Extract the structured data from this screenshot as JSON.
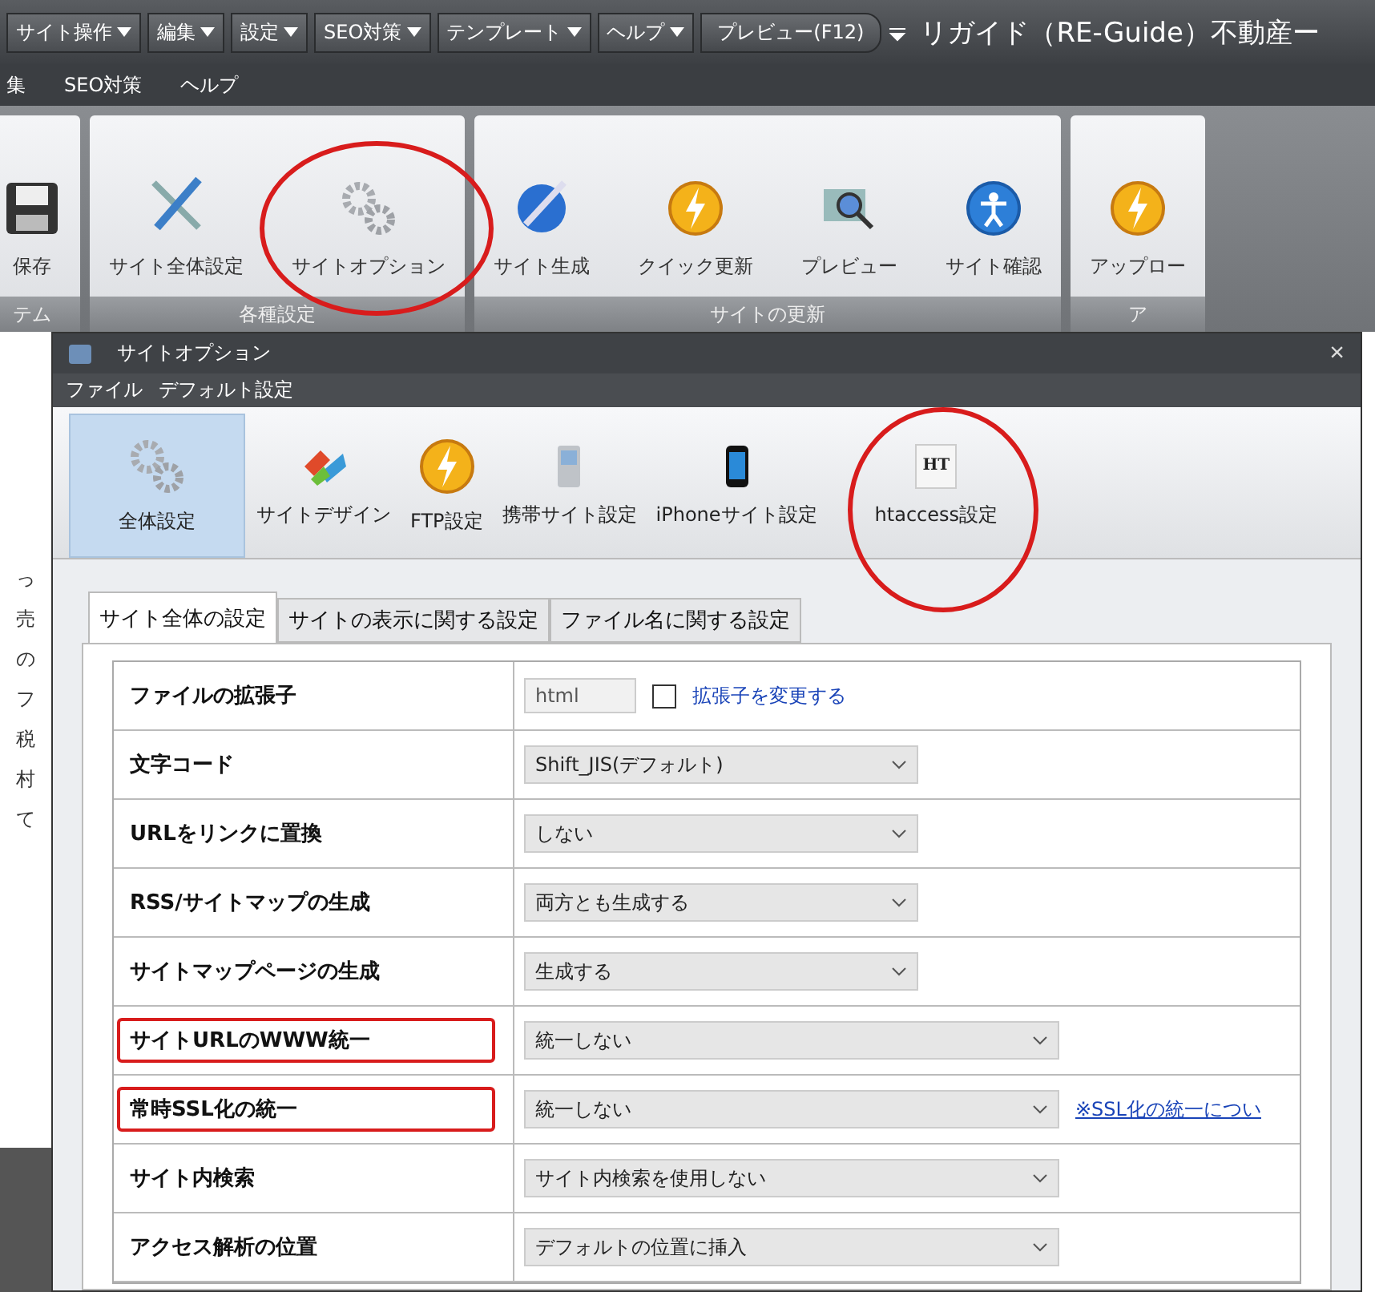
{
  "quick_bar": {
    "menus": [
      {
        "label": "サイト操作"
      },
      {
        "label": "編集"
      },
      {
        "label": "設定"
      },
      {
        "label": "SEO対策"
      },
      {
        "label": "テンプレート"
      },
      {
        "label": "ヘルプ"
      }
    ],
    "preview_button": "プレビュー(F12)",
    "title": "リガイド（RE-Guide）不動産ー"
  },
  "menu_bar": [
    "集",
    "SEO対策",
    "ヘルプ"
  ],
  "ribbon": {
    "groups": [
      {
        "label": "テム",
        "buttons": [
          {
            "label": "保存",
            "circled": false
          }
        ]
      },
      {
        "label": "各種設定",
        "buttons": [
          {
            "label": "サイト全体設定",
            "circled": false
          },
          {
            "label": "サイトオプション",
            "circled": true
          }
        ]
      },
      {
        "label": "サイトの更新",
        "buttons": [
          {
            "label": "サイト生成",
            "circled": false
          },
          {
            "label": "クイック更新",
            "circled": false
          },
          {
            "label": "プレビュー",
            "circled": false
          },
          {
            "label": "サイト確認",
            "circled": false
          }
        ]
      },
      {
        "label": "ア",
        "buttons": [
          {
            "label": "アップロー",
            "circled": false
          }
        ]
      }
    ]
  },
  "background_fragments": [
    "っ",
    "売",
    "の",
    "フ",
    "税",
    "村",
    "て"
  ],
  "dialog": {
    "title": "サイトオプション",
    "close": "×",
    "menu": [
      "ファイル",
      "デフォルト設定"
    ],
    "toolbar": [
      {
        "label": "全体設定",
        "selected": true,
        "circled": false
      },
      {
        "label": "サイトデザイン",
        "selected": false,
        "circled": false
      },
      {
        "label": "FTP設定",
        "selected": false,
        "circled": false
      },
      {
        "label": "携帯サイト設定",
        "selected": false,
        "circled": false
      },
      {
        "label": "iPhoneサイト設定",
        "selected": false,
        "circled": false
      },
      {
        "label": "htaccess設定",
        "icon_text": "HT",
        "selected": false,
        "circled": true
      }
    ],
    "tabs": [
      {
        "label": "サイト全体の設定",
        "selected": true
      },
      {
        "label": "サイトの表示に関する設定",
        "selected": false
      },
      {
        "label": "ファイル名に関する設定",
        "selected": false
      }
    ],
    "rows": [
      {
        "label": "ファイルの拡張子",
        "kind": "extension",
        "value": "html",
        "checked": false,
        "link": "拡張子を変更する",
        "highlighted": false
      },
      {
        "label": "文字コード",
        "kind": "select",
        "value": "Shift_JIS(デフォルト)",
        "highlighted": false
      },
      {
        "label": "URLをリンクに置換",
        "kind": "select",
        "value": "しない",
        "highlighted": false
      },
      {
        "label": "RSS/サイトマップの生成",
        "kind": "select",
        "value": "両方とも生成する",
        "highlighted": false
      },
      {
        "label": "サイトマップページの生成",
        "kind": "select",
        "value": "生成する",
        "highlighted": false
      },
      {
        "label": "サイトURLのWWW統一",
        "kind": "select_wide",
        "value": "統一しない",
        "highlighted": true
      },
      {
        "label": "常時SSL化の統一",
        "kind": "select_wide",
        "value": "統一しない",
        "link": "※SSL化の統一につい",
        "highlighted": true
      },
      {
        "label": "サイト内検索",
        "kind": "select_wide",
        "value": "サイト内検索を使用しない",
        "highlighted": false
      },
      {
        "label": "アクセス解析の位置",
        "kind": "select_wide",
        "value": "デフォルトの位置に挿入",
        "highlighted": false
      }
    ]
  }
}
